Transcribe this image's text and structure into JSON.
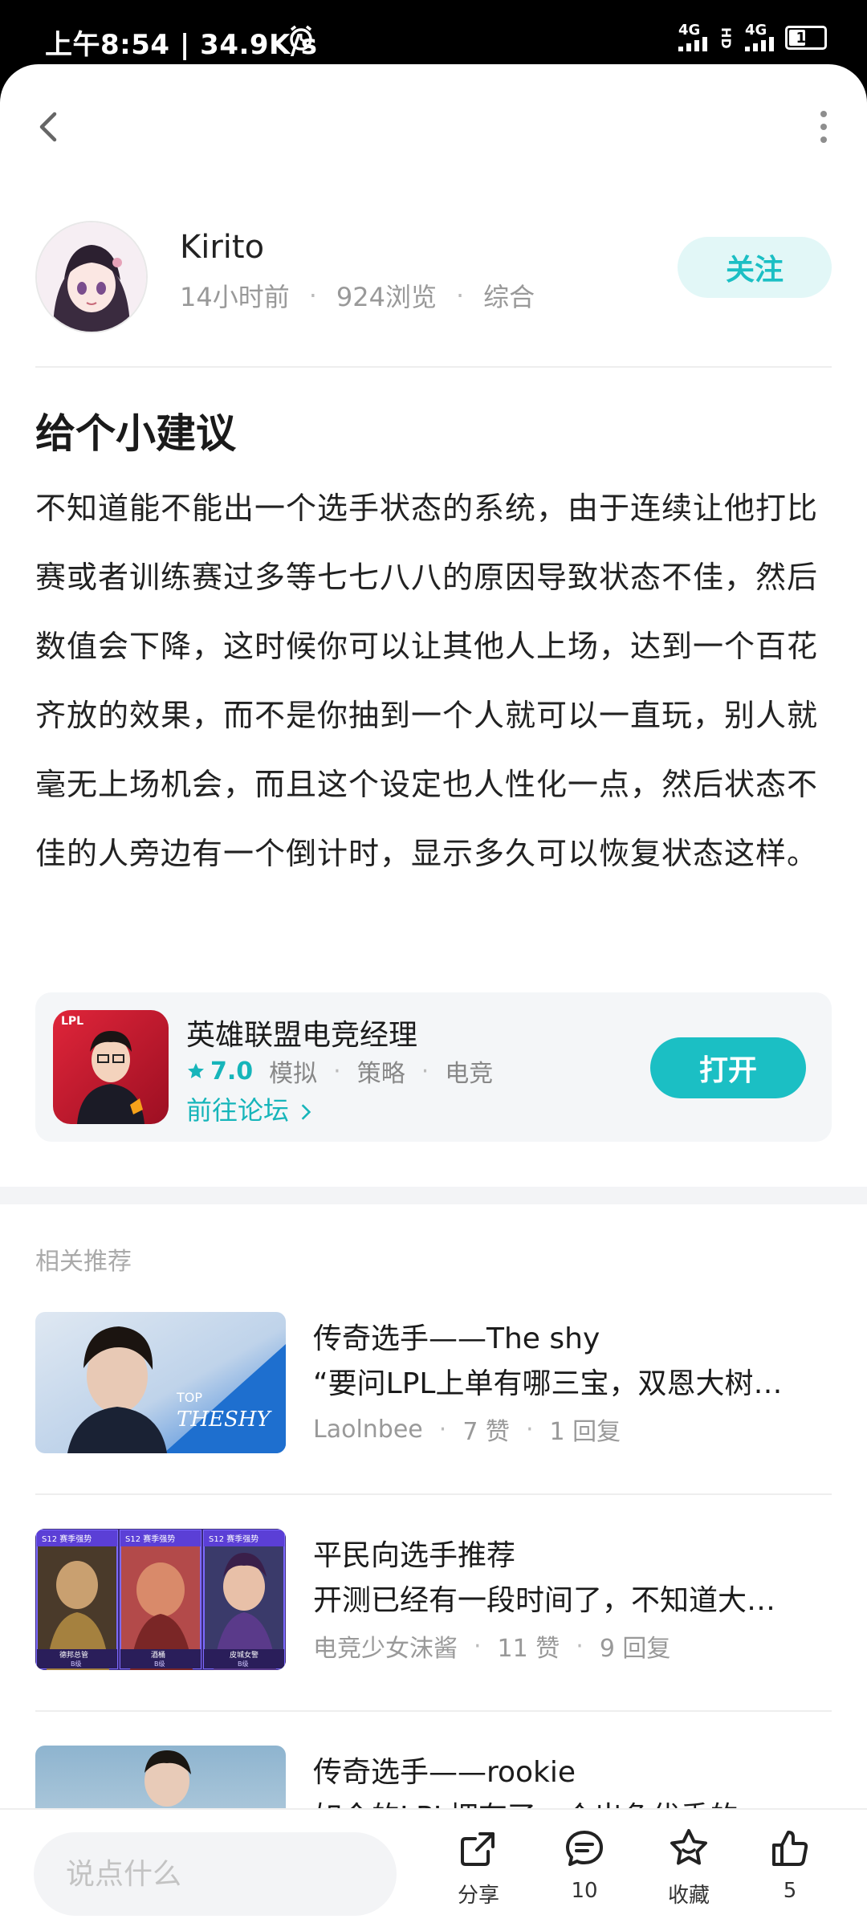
{
  "status_bar": {
    "time_speed": "上午8:54 | 34.9K/s",
    "network_1": "4G",
    "network_2": "4G",
    "hd": "HD",
    "battery": "19"
  },
  "author": {
    "name": "Kirito",
    "time": "14小时前",
    "views": "924浏览",
    "category": "综合",
    "follow_label": "关注"
  },
  "post": {
    "title": "给个小建议",
    "body": "不知道能不能出一个选手状态的系统，由于连续让他打比赛或者训练赛过多等七七八八的原因导致状态不佳，然后数值会下降，这时候你可以让其他人上场，达到一个百花齐放的效果，而不是你抽到一个人就可以一直玩，别人就毫无上场机会，而且这个设定也人性化一点，然后状态不佳的人旁边有一个倒计时，显示多久可以恢复状态这样。"
  },
  "game_card": {
    "name": "英雄联盟电竞经理",
    "rating": "7.0",
    "tags": [
      "模拟",
      "策略",
      "电竞"
    ],
    "forum_link": "前往论坛",
    "open_label": "打开",
    "icon_text": "LPL"
  },
  "recommendations": {
    "section_title": "相关推荐",
    "items": [
      {
        "title": "传奇选手——The shy",
        "snippet": "“要问LPL上单有哪三宝，双恩大树…",
        "author": "Laolnbee",
        "likes": "7 赞",
        "replies": "1 回复",
        "thumb_label_top": "TOP",
        "thumb_label_name": "THESHY"
      },
      {
        "title": "平民向选手推荐",
        "snippet": "开测已经有一段时间了，不知道大…",
        "author": "电竞少女沫酱",
        "likes": "11 赞",
        "replies": "9 回复",
        "thumb_cards": [
          {
            "badge": "S12 赛季强势",
            "name": "德邦总管",
            "tier": "B级"
          },
          {
            "badge": "S12 赛季强势",
            "name": "酒桶",
            "tier": "B级"
          },
          {
            "badge": "S12 赛季强势",
            "name": "皮城女警",
            "tier": "B级"
          }
        ]
      },
      {
        "title": "传奇选手——rookie",
        "snippet": "如今的LPL拥有了一个出色优秀的"
      }
    ]
  },
  "bottom_bar": {
    "comment_placeholder": "说点什么",
    "share_label": "分享",
    "comment_count": "10",
    "favorite_label": "收藏",
    "like_count": "5"
  },
  "colors": {
    "accent": "#1bbfc4",
    "follow_bg": "#e2f7f7",
    "card_bg": "#f4f6f8"
  }
}
